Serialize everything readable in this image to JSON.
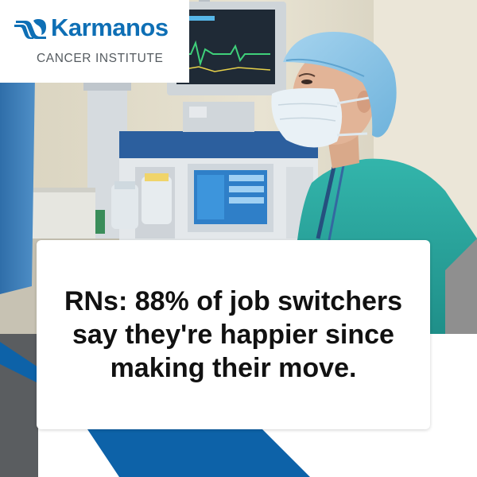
{
  "brand": {
    "name": "Karmanos",
    "subtitle": "CANCER INSTITUTE",
    "color": "#0e6fb5"
  },
  "headline": "RNs: 88% of job switchers say they're happier since making their move.",
  "colors": {
    "blue_accent": "#0d62a8",
    "gray_accent": "#5a5d60",
    "scrubs": "#2aa9a0",
    "cap": "#8ec7e6"
  }
}
